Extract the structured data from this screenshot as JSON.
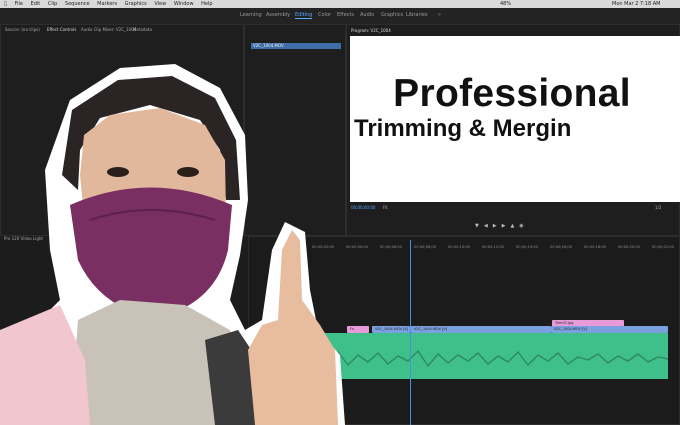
{
  "menubar": {
    "items": [
      "File",
      "Edit",
      "Clip",
      "Sequence",
      "Markers",
      "Graphics",
      "View",
      "Window",
      "Help"
    ],
    "clock": "Mon Mar 2  7:18 AM",
    "battery": "48%"
  },
  "workspaces": {
    "items": [
      "Learning",
      "Assembly",
      "Editing",
      "Color",
      "Effects",
      "Audio",
      "Graphics",
      "Libraries"
    ],
    "active": "Editing"
  },
  "left_panel": {
    "tabs": [
      "Source: (no clips)",
      "Effect Controls",
      "Audio Clip Mixer: V2C_1004",
      "Metadata"
    ]
  },
  "project_panel": {
    "item": "V2C_1004.MOV"
  },
  "program_monitor": {
    "tab": "Program: V2C_1004",
    "title_line1": "Professional",
    "title_line2": "Trimming & Mergin",
    "timecode": "00;00;00;00",
    "fit": "Fit",
    "quality": "1/2"
  },
  "timeline": {
    "sequence": "Pro 120 Video Light",
    "ruler": [
      "00;00;02;00",
      "00;00;04;00",
      "00;00;06;00",
      "00;00;08;00",
      "00;00;10;00",
      "00;00;12;00",
      "00;00;14;00",
      "00;00;16;00",
      "00;00;18;00",
      "00;00;20;00",
      "00;00;22;00"
    ],
    "clips": [
      {
        "label": "Trim02.jpg",
        "color": "#e89bd9"
      },
      {
        "label": "Fx",
        "color": "#e89bd9"
      },
      {
        "label": "V2C_1004.MOV [V]",
        "color": "#7aa0e0"
      },
      {
        "label": "V2C_1004.MOV [V]",
        "color": "#7aa0e0"
      },
      {
        "label": "V2C_1004.MOV [V]",
        "color": "#7aa0e0"
      }
    ],
    "audio_color": "#3fbf8a"
  },
  "colors": {
    "accent": "#5aa7ff",
    "shirt": "#f1c6cf",
    "mask": "#7a2f62"
  }
}
